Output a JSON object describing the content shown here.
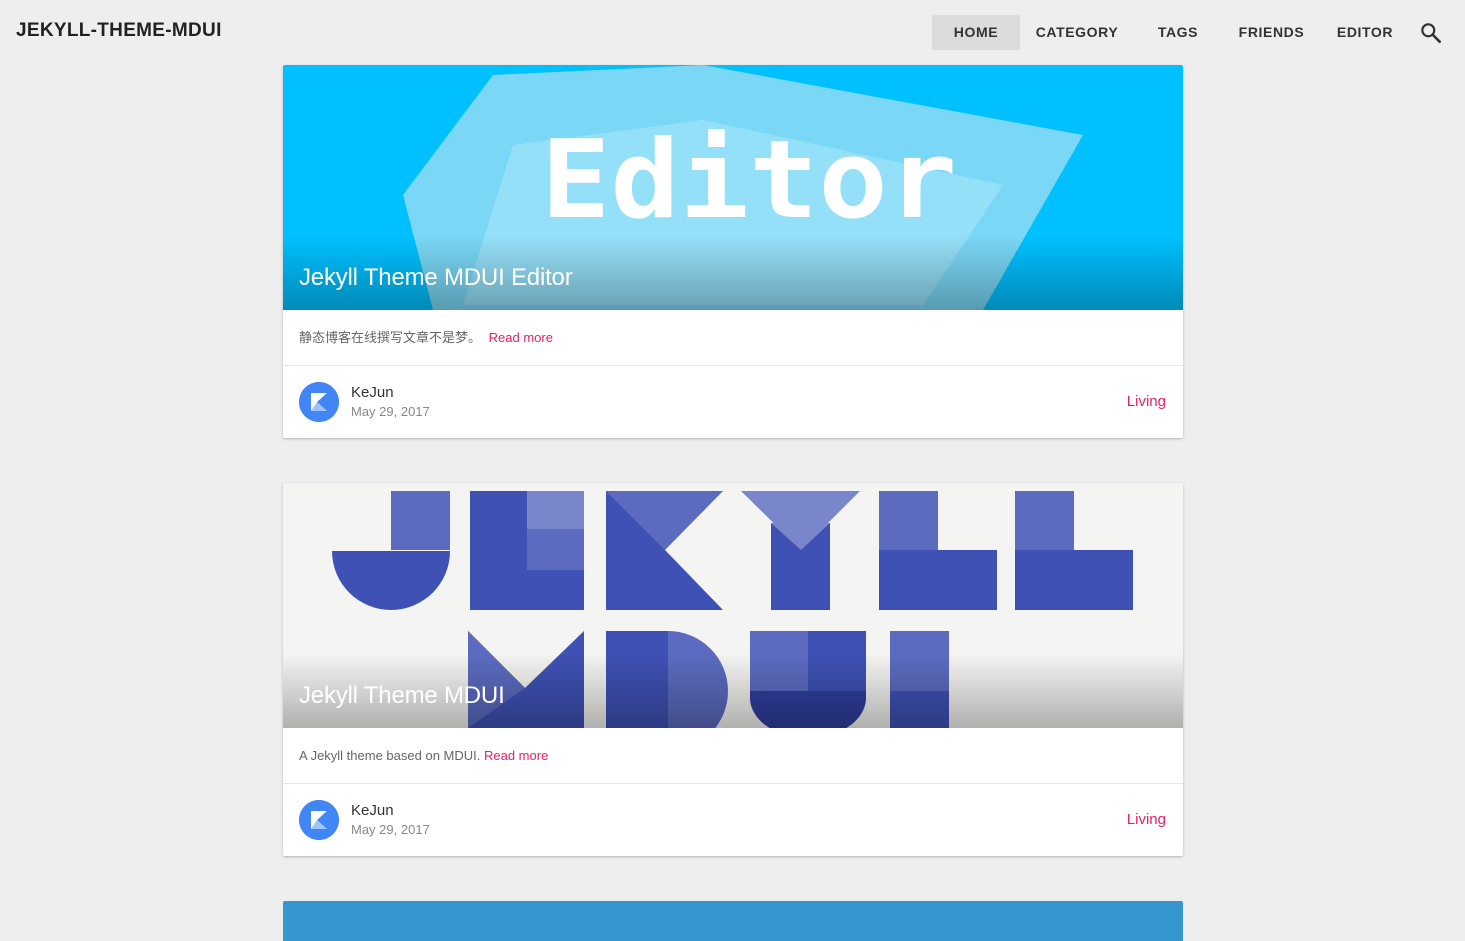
{
  "brand": "JEKYLL-THEME-MDUI",
  "nav": [
    "HOME",
    "CATEGORY",
    "TAGS",
    "FRIENDS",
    "EDITOR"
  ],
  "posts": [
    {
      "title": "Jekyll Theme MDUI Editor",
      "cover_text": "Editor",
      "excerpt": "静态博客在线撰写文章不是梦。",
      "read_more": "Read more",
      "author": "KeJun",
      "date": "May 29, 2017",
      "category": "Living"
    },
    {
      "title": "Jekyll Theme MDUI",
      "excerpt": "A Jekyll theme based on MDUI.",
      "read_more": "Read more",
      "author": "KeJun",
      "date": "May 29, 2017",
      "category": "Living"
    }
  ],
  "colors": {
    "accent": "#e91e63",
    "cover_blue": "#00c0ff",
    "logo_indigo": "#3f51b5",
    "third_card": "#3597d0"
  },
  "icons": [
    "search-icon",
    "avatar-logo-icon"
  ]
}
